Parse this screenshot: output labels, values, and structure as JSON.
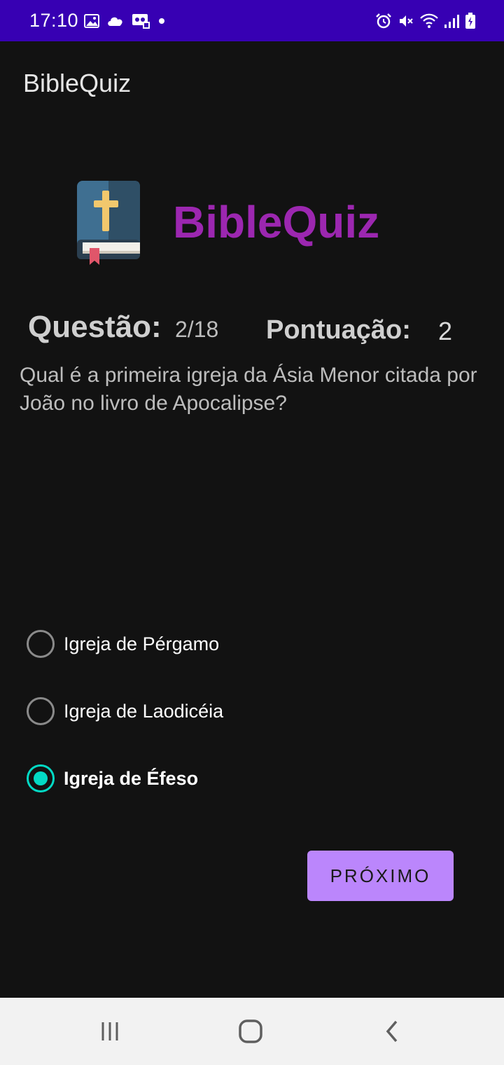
{
  "status_bar": {
    "time": "17:10",
    "left_icons": [
      "image-icon",
      "cloud-icon",
      "voicemail-icon",
      "dot-icon"
    ],
    "right_icons": [
      "alarm-icon",
      "mute-icon",
      "wifi-icon",
      "signal-icon",
      "battery-icon"
    ]
  },
  "app_bar": {
    "title": "BibleQuiz"
  },
  "header": {
    "brand_title": "BibleQuiz",
    "logo_icon": "bible-icon"
  },
  "quiz": {
    "question_label": "Questão:",
    "question_progress": "2/18",
    "score_label": "Pontuação:",
    "score_value": "2",
    "question_text": "Qual é a primeira igreja da Ásia Menor citada por João no livro de Apocalipse?",
    "options": [
      {
        "label": "Igreja de Pérgamo",
        "selected": false
      },
      {
        "label": "Igreja de Laodicéia",
        "selected": false
      },
      {
        "label": "Igreja de Éfeso",
        "selected": true
      }
    ],
    "next_label": "PRÓXIMO"
  },
  "nav_bar": {
    "items": [
      "recents-icon",
      "home-icon",
      "back-icon"
    ]
  },
  "colors": {
    "status_bar": "#3700b3",
    "background": "#121212",
    "brand": "#9c27b0",
    "accent": "#03dac5",
    "button": "#bb86fc"
  }
}
